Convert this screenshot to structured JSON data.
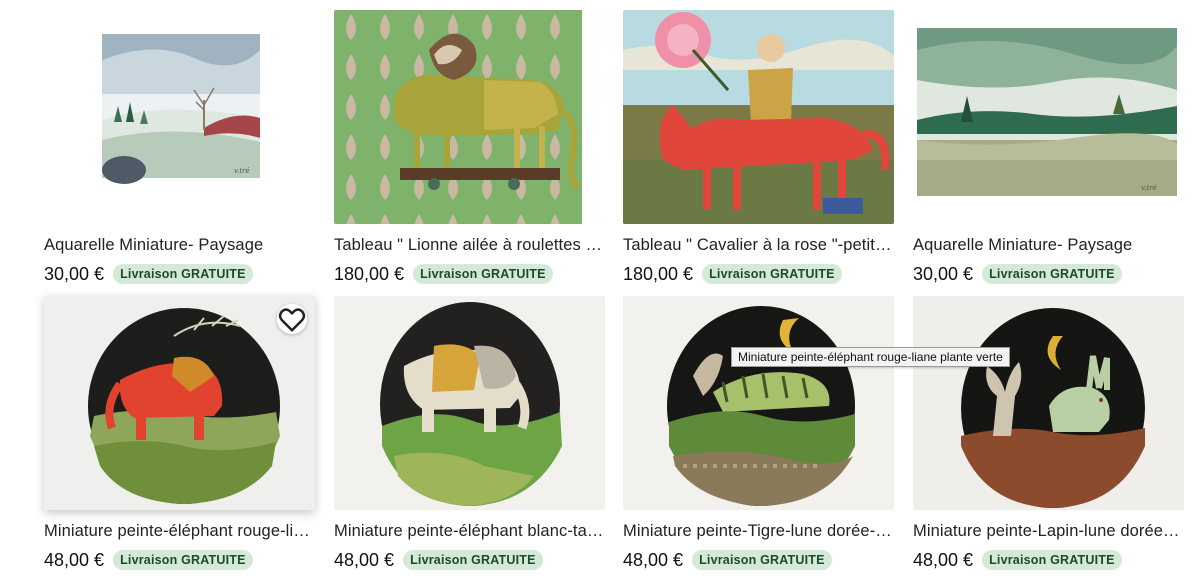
{
  "listings": [
    {
      "title": "Aquarelle Miniature- Paysage",
      "price": "30,00 €",
      "shipping_badge": "Livraison GRATUITE",
      "image": "watercolor-landscape-snow"
    },
    {
      "title": "Tableau \" Lionne ailée à roulettes \"-D...",
      "price": "180,00 €",
      "shipping_badge": "Livraison GRATUITE",
      "image": "winged-lioness-on-wheels"
    },
    {
      "title": "Tableau \" Cavalier à la rose \"-petit ch...",
      "price": "180,00 €",
      "shipping_badge": "Livraison GRATUITE",
      "image": "rider-with-rose-red-horse"
    },
    {
      "title": "Aquarelle Miniature- Paysage",
      "price": "30,00 €",
      "shipping_badge": "Livraison GRATUITE",
      "image": "watercolor-green-hills"
    },
    {
      "title": "Miniature peinte-éléphant rouge-lia...",
      "price": "48,00 €",
      "shipping_badge": "Livraison GRATUITE",
      "image": "red-elephant-oval"
    },
    {
      "title": "Miniature peinte-éléphant blanc-tapi...",
      "price": "48,00 €",
      "shipping_badge": "Livraison GRATUITE",
      "image": "white-elephant-oval"
    },
    {
      "title": "Miniature peinte-Tigre-lune dorée-pl...",
      "price": "48,00 €",
      "shipping_badge": "Livraison GRATUITE",
      "image": "tiger-golden-moon-oval"
    },
    {
      "title": "Miniature peinte-Lapin-lune dorée-p...",
      "price": "48,00 €",
      "shipping_badge": "Livraison GRATUITE",
      "image": "rabbit-golden-moon-oval"
    }
  ],
  "tooltip": "Miniature peinte-éléphant rouge-liane plante verte",
  "icons": {
    "favorite": "heart-outline-icon"
  }
}
